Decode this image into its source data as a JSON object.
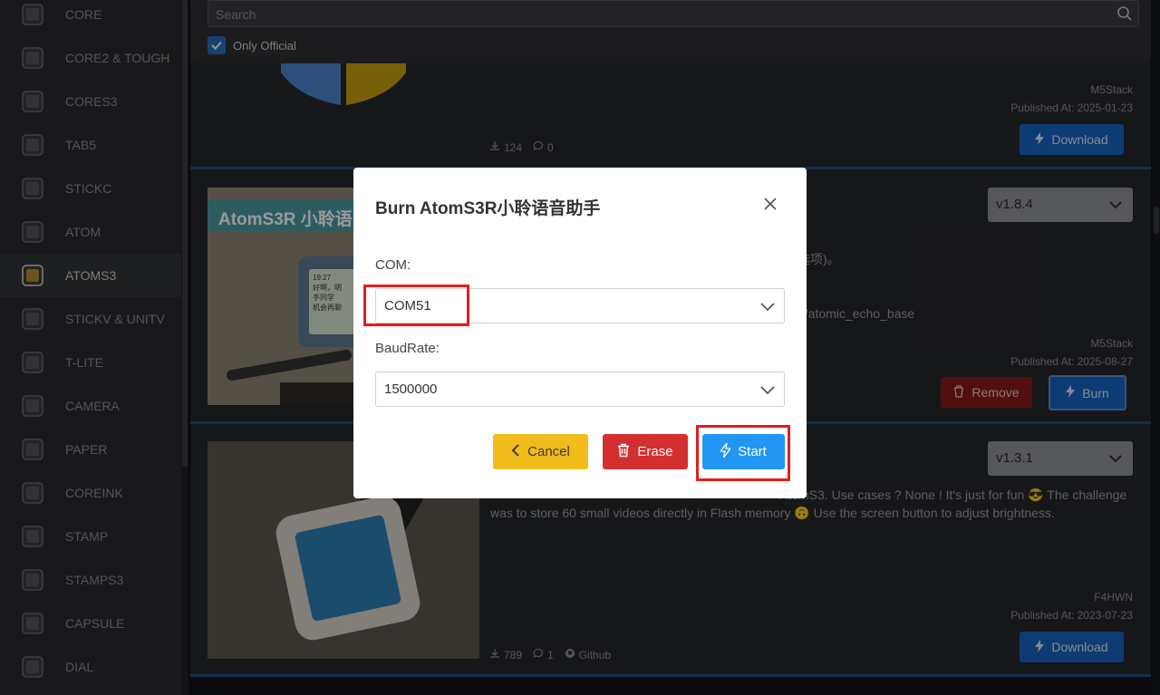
{
  "sidebar": {
    "items": [
      {
        "label": "CORE",
        "icon": "core-device-icon"
      },
      {
        "label": "CORE2 & TOUGH",
        "icon": "core2-device-icon"
      },
      {
        "label": "CORES3",
        "icon": "cores3-device-icon"
      },
      {
        "label": "TAB5",
        "icon": "tab5-device-icon"
      },
      {
        "label": "STICKC",
        "icon": "stickc-device-icon"
      },
      {
        "label": "ATOM",
        "icon": "atom-device-icon"
      },
      {
        "label": "ATOMS3",
        "icon": "atoms3-device-icon",
        "active": true
      },
      {
        "label": "STICKV & UNITV",
        "icon": "stickv-device-icon"
      },
      {
        "label": "T-LITE",
        "icon": "tlite-device-icon"
      },
      {
        "label": "CAMERA",
        "icon": "camera-device-icon"
      },
      {
        "label": "PAPER",
        "icon": "paper-device-icon"
      },
      {
        "label": "COREINK",
        "icon": "coreink-device-icon"
      },
      {
        "label": "STAMP",
        "icon": "stamp-device-icon"
      },
      {
        "label": "STAMPS3",
        "icon": "stamps3-device-icon"
      },
      {
        "label": "CAPSULE",
        "icon": "capsule-device-icon"
      },
      {
        "label": "DIAL",
        "icon": "dial-device-icon"
      }
    ]
  },
  "search": {
    "placeholder": "Search",
    "only_official_label": "Only Official",
    "only_official_checked": true
  },
  "cards": [
    {
      "author": "M5Stack",
      "published": "Published At: 2025-01-23",
      "downloads": "124",
      "comments": "0",
      "download_label": "Download"
    },
    {
      "image_caption": "AtomS3R 小聆语",
      "screen_text": [
        "19:27",
        "好啊，明",
        "手同学",
        "机会再聊"
      ],
      "version": "v1.8.4",
      "desc_fragment_1": "选项)。",
      "desc_fragment_2": "g/atomic_echo_base",
      "author": "M5Stack",
      "published": "Published At: 2025-08-27",
      "remove_label": "Remove",
      "burn_label": "Burn"
    },
    {
      "version": "v1.3.1",
      "desc_line1_visible": "AtomS3. Use cases ? None ! It's just for fun 😎 The challenge",
      "desc_line2": "was to store 60 small videos directly in Flash memory 🙃 Use the screen button to adjust brightness.",
      "author": "F4HWN",
      "published": "Published At: 2023-07-23",
      "downloads": "789",
      "comments": "1",
      "github_label": "Github",
      "download_label": "Download"
    }
  ],
  "modal": {
    "title": "Burn AtomS3R小聆语音助手",
    "com_label": "COM:",
    "com_value": "COM51",
    "baud_label": "BaudRate:",
    "baud_value": "1500000",
    "cancel_label": "Cancel",
    "erase_label": "Erase",
    "start_label": "Start"
  },
  "colors": {
    "accent_blue": "#1565c0",
    "start_blue": "#2196f3",
    "danger_red": "#d32f2f",
    "warning_yellow": "#fbc02d",
    "highlight_red": "#e51c1c"
  }
}
